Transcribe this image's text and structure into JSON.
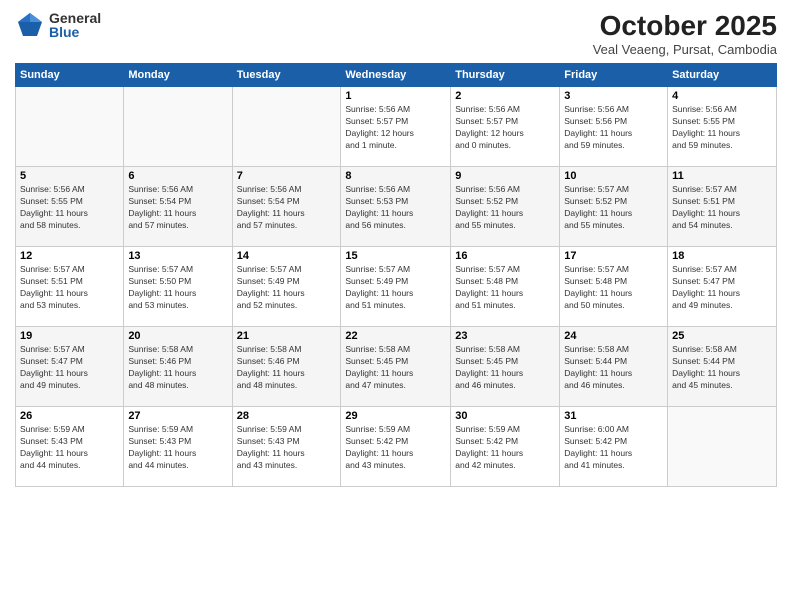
{
  "header": {
    "logo_general": "General",
    "logo_blue": "Blue",
    "month_title": "October 2025",
    "subtitle": "Veal Veaeng, Pursat, Cambodia"
  },
  "weekdays": [
    "Sunday",
    "Monday",
    "Tuesday",
    "Wednesday",
    "Thursday",
    "Friday",
    "Saturday"
  ],
  "weeks": [
    [
      {
        "day": "",
        "info": ""
      },
      {
        "day": "",
        "info": ""
      },
      {
        "day": "",
        "info": ""
      },
      {
        "day": "1",
        "info": "Sunrise: 5:56 AM\nSunset: 5:57 PM\nDaylight: 12 hours\nand 1 minute."
      },
      {
        "day": "2",
        "info": "Sunrise: 5:56 AM\nSunset: 5:57 PM\nDaylight: 12 hours\nand 0 minutes."
      },
      {
        "day": "3",
        "info": "Sunrise: 5:56 AM\nSunset: 5:56 PM\nDaylight: 11 hours\nand 59 minutes."
      },
      {
        "day": "4",
        "info": "Sunrise: 5:56 AM\nSunset: 5:55 PM\nDaylight: 11 hours\nand 59 minutes."
      }
    ],
    [
      {
        "day": "5",
        "info": "Sunrise: 5:56 AM\nSunset: 5:55 PM\nDaylight: 11 hours\nand 58 minutes."
      },
      {
        "day": "6",
        "info": "Sunrise: 5:56 AM\nSunset: 5:54 PM\nDaylight: 11 hours\nand 57 minutes."
      },
      {
        "day": "7",
        "info": "Sunrise: 5:56 AM\nSunset: 5:54 PM\nDaylight: 11 hours\nand 57 minutes."
      },
      {
        "day": "8",
        "info": "Sunrise: 5:56 AM\nSunset: 5:53 PM\nDaylight: 11 hours\nand 56 minutes."
      },
      {
        "day": "9",
        "info": "Sunrise: 5:56 AM\nSunset: 5:52 PM\nDaylight: 11 hours\nand 55 minutes."
      },
      {
        "day": "10",
        "info": "Sunrise: 5:57 AM\nSunset: 5:52 PM\nDaylight: 11 hours\nand 55 minutes."
      },
      {
        "day": "11",
        "info": "Sunrise: 5:57 AM\nSunset: 5:51 PM\nDaylight: 11 hours\nand 54 minutes."
      }
    ],
    [
      {
        "day": "12",
        "info": "Sunrise: 5:57 AM\nSunset: 5:51 PM\nDaylight: 11 hours\nand 53 minutes."
      },
      {
        "day": "13",
        "info": "Sunrise: 5:57 AM\nSunset: 5:50 PM\nDaylight: 11 hours\nand 53 minutes."
      },
      {
        "day": "14",
        "info": "Sunrise: 5:57 AM\nSunset: 5:49 PM\nDaylight: 11 hours\nand 52 minutes."
      },
      {
        "day": "15",
        "info": "Sunrise: 5:57 AM\nSunset: 5:49 PM\nDaylight: 11 hours\nand 51 minutes."
      },
      {
        "day": "16",
        "info": "Sunrise: 5:57 AM\nSunset: 5:48 PM\nDaylight: 11 hours\nand 51 minutes."
      },
      {
        "day": "17",
        "info": "Sunrise: 5:57 AM\nSunset: 5:48 PM\nDaylight: 11 hours\nand 50 minutes."
      },
      {
        "day": "18",
        "info": "Sunrise: 5:57 AM\nSunset: 5:47 PM\nDaylight: 11 hours\nand 49 minutes."
      }
    ],
    [
      {
        "day": "19",
        "info": "Sunrise: 5:57 AM\nSunset: 5:47 PM\nDaylight: 11 hours\nand 49 minutes."
      },
      {
        "day": "20",
        "info": "Sunrise: 5:58 AM\nSunset: 5:46 PM\nDaylight: 11 hours\nand 48 minutes."
      },
      {
        "day": "21",
        "info": "Sunrise: 5:58 AM\nSunset: 5:46 PM\nDaylight: 11 hours\nand 48 minutes."
      },
      {
        "day": "22",
        "info": "Sunrise: 5:58 AM\nSunset: 5:45 PM\nDaylight: 11 hours\nand 47 minutes."
      },
      {
        "day": "23",
        "info": "Sunrise: 5:58 AM\nSunset: 5:45 PM\nDaylight: 11 hours\nand 46 minutes."
      },
      {
        "day": "24",
        "info": "Sunrise: 5:58 AM\nSunset: 5:44 PM\nDaylight: 11 hours\nand 46 minutes."
      },
      {
        "day": "25",
        "info": "Sunrise: 5:58 AM\nSunset: 5:44 PM\nDaylight: 11 hours\nand 45 minutes."
      }
    ],
    [
      {
        "day": "26",
        "info": "Sunrise: 5:59 AM\nSunset: 5:43 PM\nDaylight: 11 hours\nand 44 minutes."
      },
      {
        "day": "27",
        "info": "Sunrise: 5:59 AM\nSunset: 5:43 PM\nDaylight: 11 hours\nand 44 minutes."
      },
      {
        "day": "28",
        "info": "Sunrise: 5:59 AM\nSunset: 5:43 PM\nDaylight: 11 hours\nand 43 minutes."
      },
      {
        "day": "29",
        "info": "Sunrise: 5:59 AM\nSunset: 5:42 PM\nDaylight: 11 hours\nand 43 minutes."
      },
      {
        "day": "30",
        "info": "Sunrise: 5:59 AM\nSunset: 5:42 PM\nDaylight: 11 hours\nand 42 minutes."
      },
      {
        "day": "31",
        "info": "Sunrise: 6:00 AM\nSunset: 5:42 PM\nDaylight: 11 hours\nand 41 minutes."
      },
      {
        "day": "",
        "info": ""
      }
    ]
  ]
}
